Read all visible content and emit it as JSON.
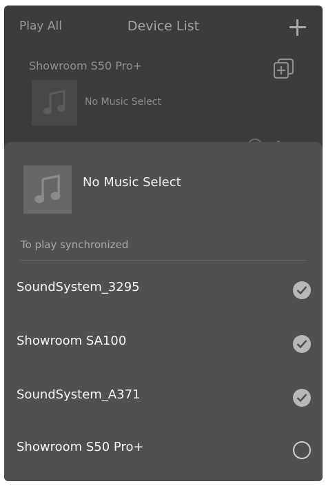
{
  "topbar": {
    "play_all": "Play All",
    "title": "Device List"
  },
  "device_card": {
    "name": "Showroom S50 Pro+",
    "now_playing": "No Music Select"
  },
  "sync_sheet": {
    "now_playing": "No Music Select",
    "sync_label": "To play synchronized",
    "devices": [
      {
        "name": "SoundSystem_3295",
        "selected": true
      },
      {
        "name": "Showroom SA100",
        "selected": true
      },
      {
        "name": "SoundSystem_A371",
        "selected": true
      },
      {
        "name": "Showroom S50 Pro+",
        "selected": false
      }
    ]
  },
  "icons": {
    "add": "plus-icon",
    "group": "group-add-icon",
    "music": "music-note-icon",
    "check": "check-icon"
  },
  "colors": {
    "background": "#3c3c3c",
    "sheet": "#505050",
    "check_on": "#b8b8b8"
  }
}
